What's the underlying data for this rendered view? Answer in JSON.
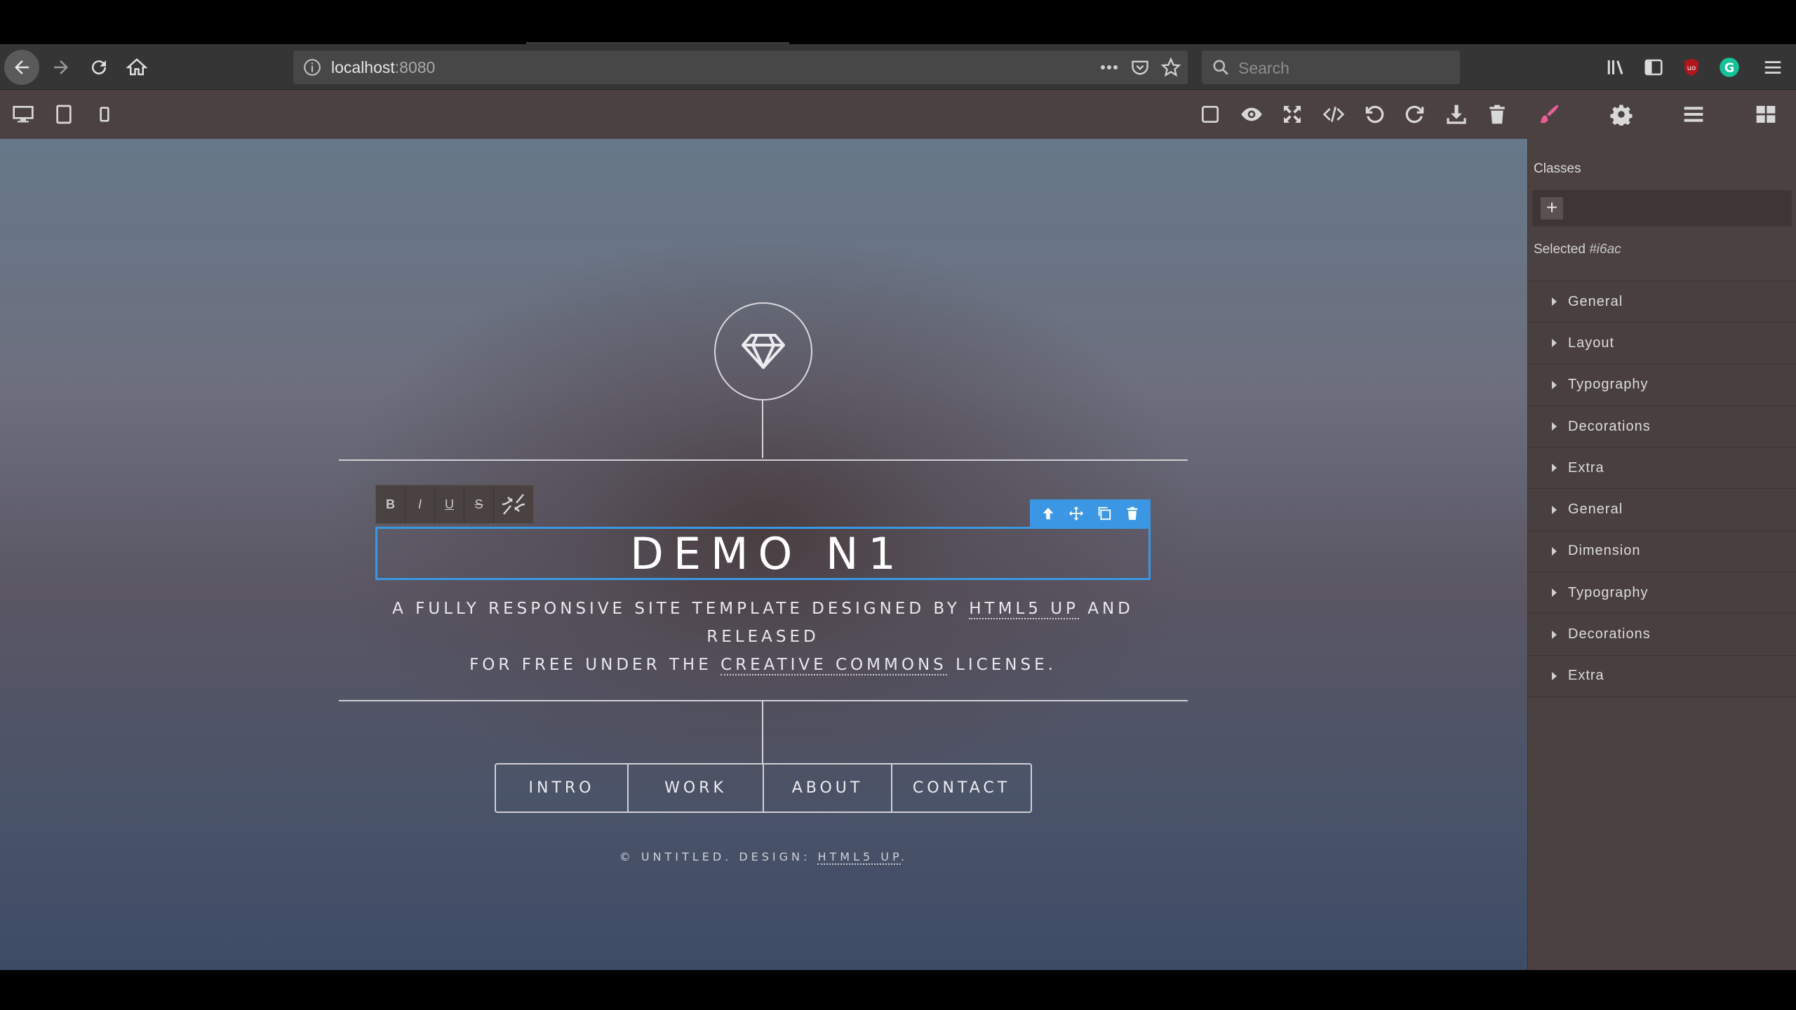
{
  "browser": {
    "url_host": "localhost",
    "url_port": ":8080",
    "search_placeholder": "Search"
  },
  "canvas": {
    "title": "DEMO N1",
    "subtitle_line1_a": "A FULLY RESPONSIVE SITE TEMPLATE DESIGNED BY ",
    "subtitle_link1": "HTML5 UP",
    "subtitle_line1_b": " AND RELEASED",
    "subtitle_line2_a": "FOR FREE UNDER THE ",
    "subtitle_link2": "CREATIVE COMMONS",
    "subtitle_line2_b": " LICENSE.",
    "nav": [
      "INTRO",
      "WORK",
      "ABOUT",
      "CONTACT"
    ],
    "footer_a": "© UNTITLED. DESIGN: ",
    "footer_link": "HTML5 UP",
    "footer_b": "."
  },
  "rte": {
    "bold": "B",
    "italic": "I",
    "underline": "U",
    "strike": "S"
  },
  "panel": {
    "classes_label": "Classes",
    "add_label": "+",
    "selected_label": "Selected ",
    "selected_id": "#i6ac",
    "sectors": [
      "General",
      "Layout",
      "Typography",
      "Decorations",
      "Extra",
      "General",
      "Dimension",
      "Typography",
      "Decorations",
      "Extra"
    ]
  },
  "colors": {
    "accent": "#3b97e3",
    "panel_bg": "#4b4141",
    "active_brush": "#e85f97"
  },
  "icons": {
    "device_desktop": "desktop-icon",
    "device_tablet": "tablet-icon",
    "device_mobile": "mobile-icon",
    "right_panel": [
      "brush-icon",
      "gear-icon",
      "layers-icon",
      "blocks-icon"
    ]
  }
}
